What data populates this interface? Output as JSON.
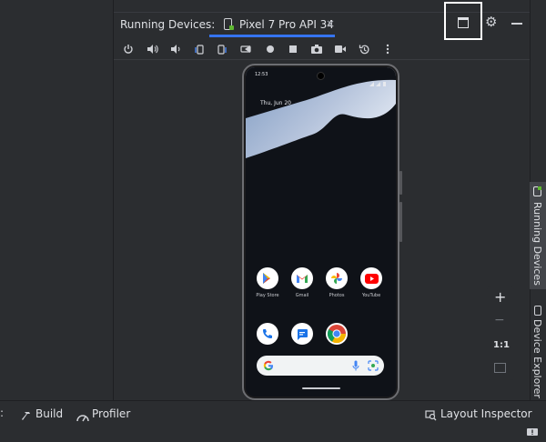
{
  "header": {
    "panel_title": "Running Devices:",
    "device_tab": "Pixel 7 Pro API 34",
    "close_glyph": "×"
  },
  "toolbar": {
    "icons": [
      "power-icon",
      "volume-up-icon",
      "volume-down-icon",
      "rotate-left-icon",
      "rotate-right-icon",
      "fold-icon",
      "back-icon",
      "home-icon",
      "overview-icon",
      "screenshot-icon",
      "record-icon",
      "snapshot-icon",
      "more-icon"
    ]
  },
  "phone": {
    "status_time": "12:53",
    "date_text": "Thu, Jun 20",
    "apps_row1": [
      "Play Store",
      "Gmail",
      "Photos",
      "YouTube"
    ],
    "apps_row2": [
      "Phone",
      "Messages",
      "Chrome"
    ]
  },
  "right_sidebar": {
    "running_devices": "Running Devices",
    "device_explorer": "Device Explorer"
  },
  "zoom": {
    "plus": "+",
    "minus": "−",
    "one_to_one": "1:1"
  },
  "bottom_bar": {
    "build": "Build",
    "profiler": "Profiler",
    "layout_inspector": "Layout Inspector"
  },
  "colors": {
    "accent": "#3574f0",
    "background": "#2b2d30",
    "highlight": "#ffffff"
  }
}
